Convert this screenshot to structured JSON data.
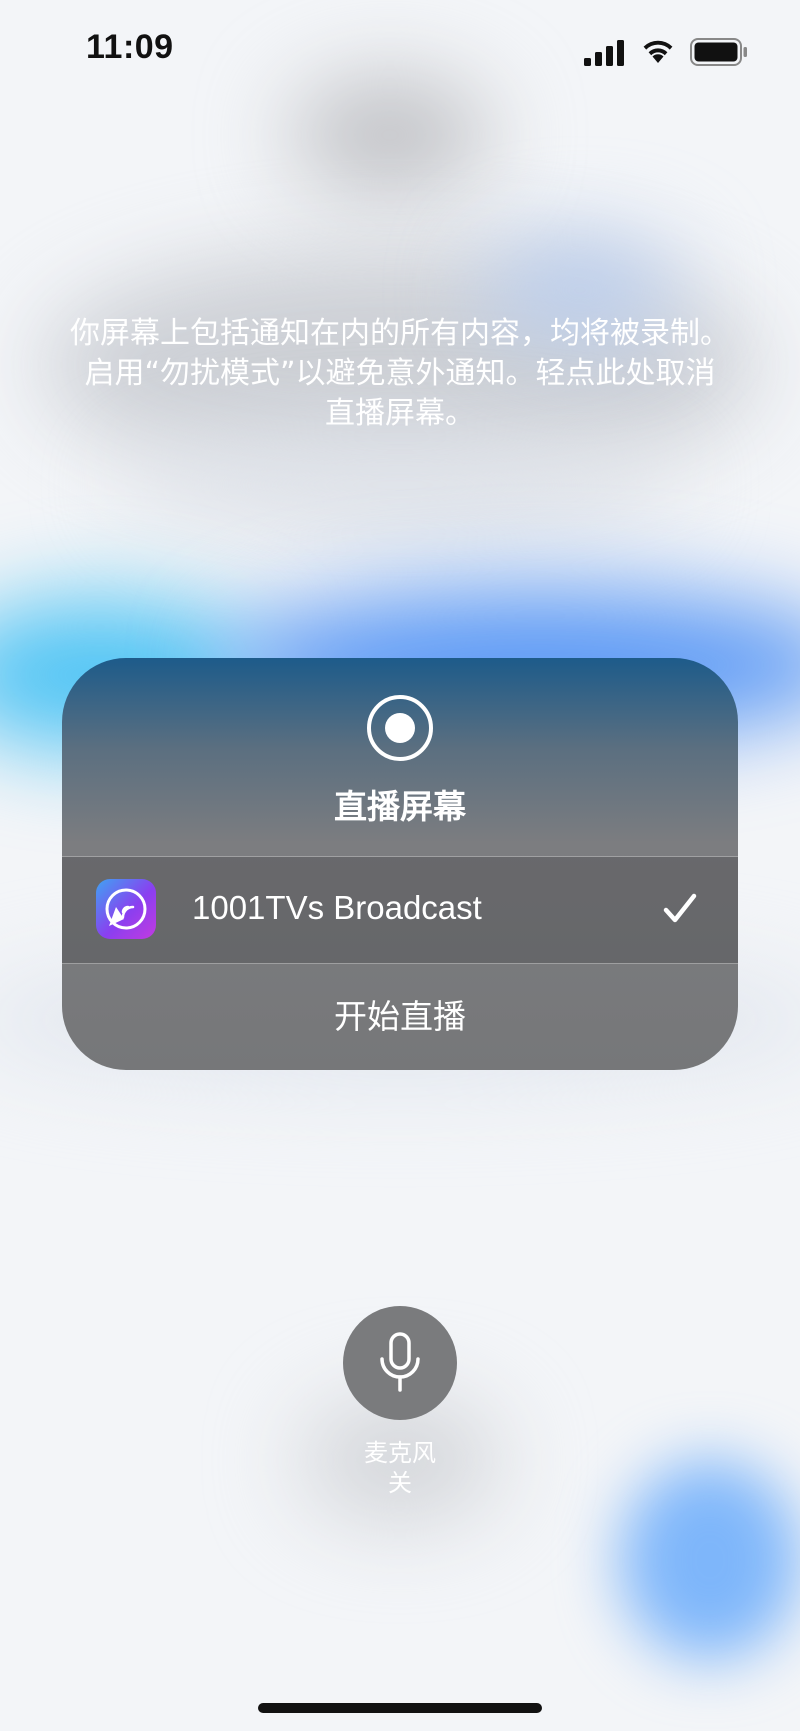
{
  "status_bar": {
    "time": "11:09",
    "signal_icon": "cellular-signal-icon",
    "wifi_icon": "wifi-icon",
    "battery_icon": "battery-icon"
  },
  "notice": {
    "text": "你屏幕上包括通知在内的所有内容，均将被录制。启用“勿扰模式”以避免意外通知。轻点此处取消直播屏幕。"
  },
  "panel": {
    "title": "直播屏幕",
    "icon": "record-icon",
    "app": {
      "name": "1001TVs Broadcast",
      "icon": "broadcast-app-icon",
      "selected_icon": "checkmark-icon"
    },
    "start_label": "开始直播"
  },
  "microphone": {
    "icon": "microphone-icon",
    "label": "麦克风\n关"
  }
}
